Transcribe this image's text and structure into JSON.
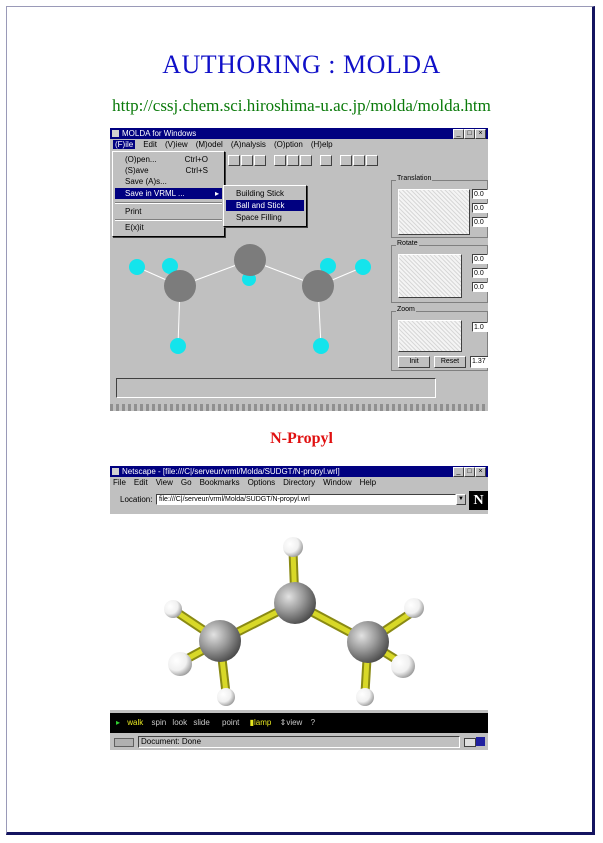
{
  "page": {
    "title": "AUTHORING : MOLDA",
    "url": "http://cssj.chem.sci.hiroshima-u.ac.jp/molda/molda.htm",
    "caption": "N-Propyl"
  },
  "molda": {
    "window_title": "MOLDA for Windows",
    "menubar": [
      "(F)ile",
      "Edit",
      "(V)iew",
      "(M)odel",
      "(A)nalysis",
      "(O)ption",
      "(H)elp"
    ],
    "file_menu": [
      {
        "label": "(O)pen...",
        "shortcut": "Ctrl+O"
      },
      {
        "label": "(S)ave",
        "shortcut": "Ctrl+S"
      },
      {
        "label": "Save (A)s...",
        "shortcut": ""
      },
      {
        "label": "Save in VRML ...",
        "shortcut": ""
      },
      {
        "label": "Print",
        "shortcut": ""
      },
      {
        "label": "E(x)it",
        "shortcut": ""
      }
    ],
    "vrml_submenu": [
      "Building Stick",
      "Ball and Stick",
      "Space Filling"
    ],
    "panels": {
      "translation": "Translation",
      "rotate": "Rotate",
      "zoom": "Zoom"
    },
    "translation_values": [
      "0.0",
      "0.0",
      "0.0"
    ],
    "rotate_values": [
      "0.0",
      "0.0",
      "0.0"
    ],
    "zoom_value": "1.0",
    "bottom_buttons": [
      "Init",
      "Reset",
      "1.37"
    ],
    "colors": {
      "carbon": "#7c7c7c",
      "hydrogen": "#14e4ec",
      "bond": "#ffffff",
      "canvas": "#c0c0c0"
    }
  },
  "netscape": {
    "window_title": "Netscape - [file:///C|/serveur/vrml/Molda/SUDGT/N-propyl.wrl]",
    "menubar": [
      "File",
      "Edit",
      "View",
      "Go",
      "Bookmarks",
      "Options",
      "Directory",
      "Window",
      "Help"
    ],
    "location_label": "Location:",
    "location_value": "file:///C|/serveur/vrml/Molda/SUDGT/N-propyl.wrl",
    "logo": "N",
    "vrml_toolbar": [
      "walk",
      "spin",
      "look",
      "slide",
      "point",
      "lamp",
      "view",
      "?"
    ],
    "status_text": "Document: Done",
    "colors": {
      "carbon": "#9a9a9a",
      "hydrogen": "#ffffff",
      "bond": "#d8d828",
      "background": "#ffffff"
    }
  }
}
